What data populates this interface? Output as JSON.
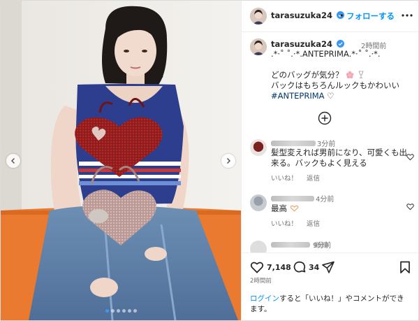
{
  "header": {
    "username": "tarasuzuka24",
    "separator": "•",
    "follow_label": "フォローする"
  },
  "caption": {
    "username": "tarasuzuka24",
    "time": "2時間前",
    "line1": ".*·˚ ˚.·*.ANTEPRIMA.*·˚ ˚.·*.",
    "line3": "どのバッグが気分？",
    "line4": "バックはもちろんルックもかわいい",
    "hashtag": "#ANTEPRIMA",
    "heart": "♡"
  },
  "comments": [
    {
      "time": "3分前",
      "text_line1": "髪型変えれば男前になり、可愛くも出",
      "text_line2": "来る。バックもよく見える",
      "like_label": "いいね！",
      "reply_label": "返信"
    },
    {
      "time": "4分前",
      "text": "最高",
      "like_label": "いいね！",
      "reply_label": "返信"
    },
    {
      "time": "9分前"
    }
  ],
  "actions": {
    "like_count": "7,148",
    "comment_count": "34"
  },
  "post_time": "2時間前",
  "login": {
    "link": "ログイン",
    "line1_rest": "すると「いいね！」やコメントができ",
    "line2": "ます。"
  },
  "carousel": {
    "slide_count": 6,
    "active_index": 0
  },
  "colors": {
    "accent": "#0095f6",
    "verified": "#3897f0",
    "hashtag": "#00376b",
    "secondary_text": "#737373",
    "dot_active": "#3e97f0"
  },
  "icons": [
    "verified-badge-icon",
    "more-options-icon",
    "heart-icon",
    "comment-icon",
    "share-icon",
    "bookmark-icon",
    "plus-circle-icon",
    "chevron-left-icon",
    "chevron-right-icon"
  ]
}
